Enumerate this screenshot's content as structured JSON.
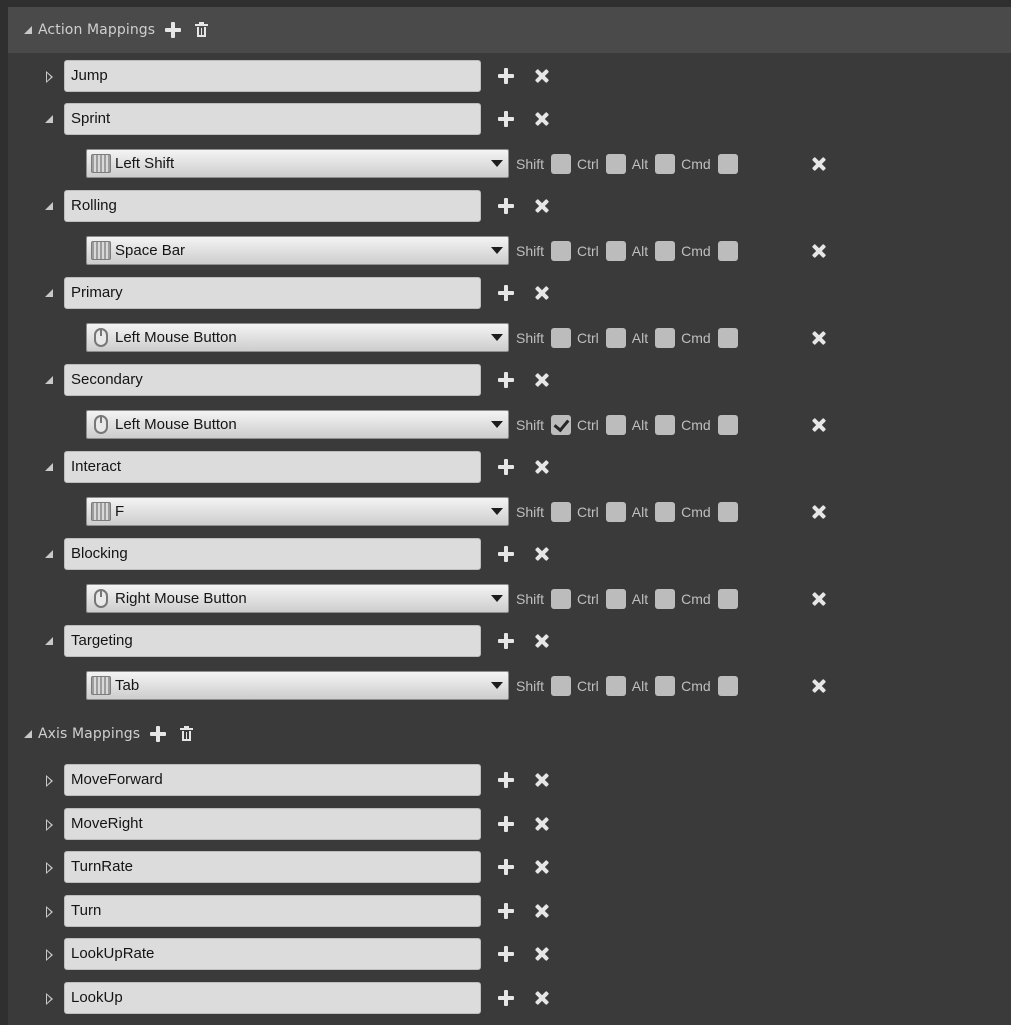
{
  "action_section": {
    "label": "Action Mappings"
  },
  "axis_section": {
    "label": "Axis Mappings"
  },
  "modifiers": [
    "Shift",
    "Ctrl",
    "Alt",
    "Cmd"
  ],
  "actions": [
    {
      "name": "Jump",
      "expanded": false,
      "key": null
    },
    {
      "name": "Sprint",
      "expanded": true,
      "key": {
        "label": "Left Shift",
        "device": "keyboard",
        "checked": [
          false,
          false,
          false,
          false
        ]
      }
    },
    {
      "name": "Rolling",
      "expanded": true,
      "key": {
        "label": "Space Bar",
        "device": "keyboard",
        "checked": [
          false,
          false,
          false,
          false
        ]
      }
    },
    {
      "name": "Primary",
      "expanded": true,
      "key": {
        "label": "Left Mouse Button",
        "device": "mouse",
        "checked": [
          false,
          false,
          false,
          false
        ]
      }
    },
    {
      "name": "Secondary",
      "expanded": true,
      "key": {
        "label": "Left Mouse Button",
        "device": "mouse",
        "checked": [
          true,
          false,
          false,
          false
        ]
      }
    },
    {
      "name": "Interact",
      "expanded": true,
      "key": {
        "label": "F",
        "device": "keyboard",
        "checked": [
          false,
          false,
          false,
          false
        ]
      }
    },
    {
      "name": "Blocking",
      "expanded": true,
      "key": {
        "label": "Right Mouse Button",
        "device": "mouse",
        "checked": [
          false,
          false,
          false,
          false
        ]
      }
    },
    {
      "name": "Targeting",
      "expanded": true,
      "key": {
        "label": "Tab",
        "device": "keyboard",
        "checked": [
          false,
          false,
          false,
          false
        ]
      }
    }
  ],
  "axes": [
    {
      "name": "MoveForward"
    },
    {
      "name": "MoveRight"
    },
    {
      "name": "TurnRate"
    },
    {
      "name": "Turn"
    },
    {
      "name": "LookUpRate"
    },
    {
      "name": "LookUp"
    }
  ]
}
